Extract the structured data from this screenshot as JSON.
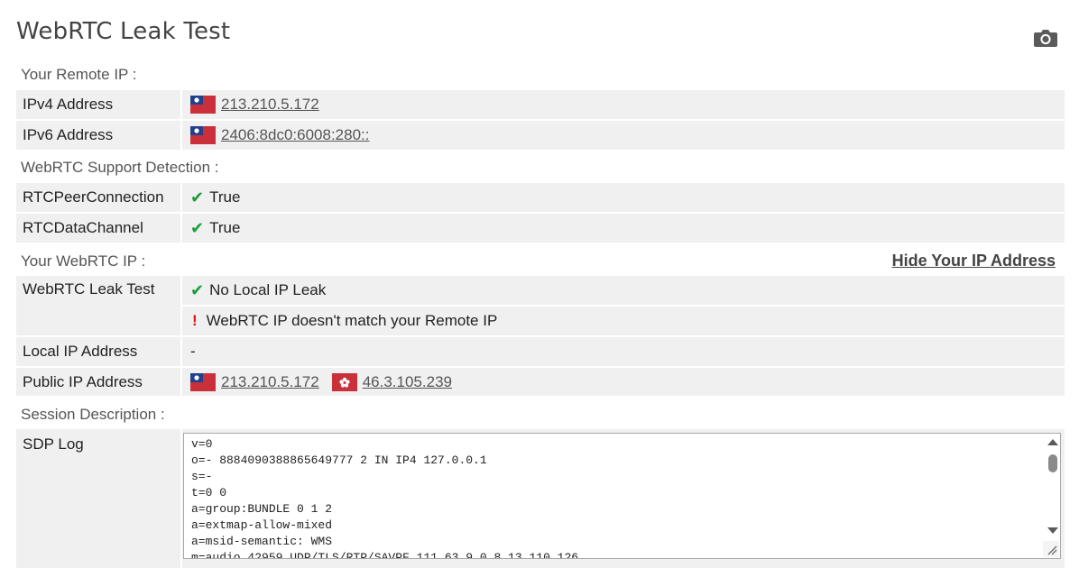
{
  "title": "WebRTC Leak Test",
  "icons": {
    "camera": "camera-icon",
    "check": "checkmark-icon",
    "warning": "exclamation-icon",
    "flag_tw": "taiwan-flag-icon",
    "flag_hk": "hong-kong-flag-icon"
  },
  "colors": {
    "check": "#1a9e3a",
    "warning": "#e01010",
    "row_bg": "#f0f0f0"
  },
  "remote": {
    "heading": "Your Remote IP :",
    "ipv4_label": "IPv4 Address",
    "ipv4_value": "213.210.5.172",
    "ipv6_label": "IPv6 Address",
    "ipv6_value": "2406:8dc0:6008:280::"
  },
  "support": {
    "heading": "WebRTC Support Detection :",
    "peer_label": "RTCPeerConnection",
    "peer_value": "True",
    "channel_label": "RTCDataChannel",
    "channel_value": "True"
  },
  "webrtc": {
    "heading": "Your WebRTC IP :",
    "hide_link": "Hide Your IP Address",
    "leak_label": "WebRTC Leak Test",
    "leak_result": "No Local IP Leak",
    "mismatch_note": "WebRTC IP doesn't match your Remote IP",
    "local_label": "Local IP Address",
    "local_value": "-",
    "public_label": "Public IP Address",
    "public_ip_1": "213.210.5.172",
    "public_ip_2": "46.3.105.239"
  },
  "session": {
    "heading": "Session Description :",
    "sdp_label": "SDP Log",
    "sdp_text": "v=0\no=- 8884090388865649777 2 IN IP4 127.0.0.1\ns=-\nt=0 0\na=group:BUNDLE 0 1 2\na=extmap-allow-mixed\na=msid-semantic: WMS\nm=audio 42959 UDP/TLS/RTP/SAVPF 111 63 9 0 8 13 110 126"
  }
}
